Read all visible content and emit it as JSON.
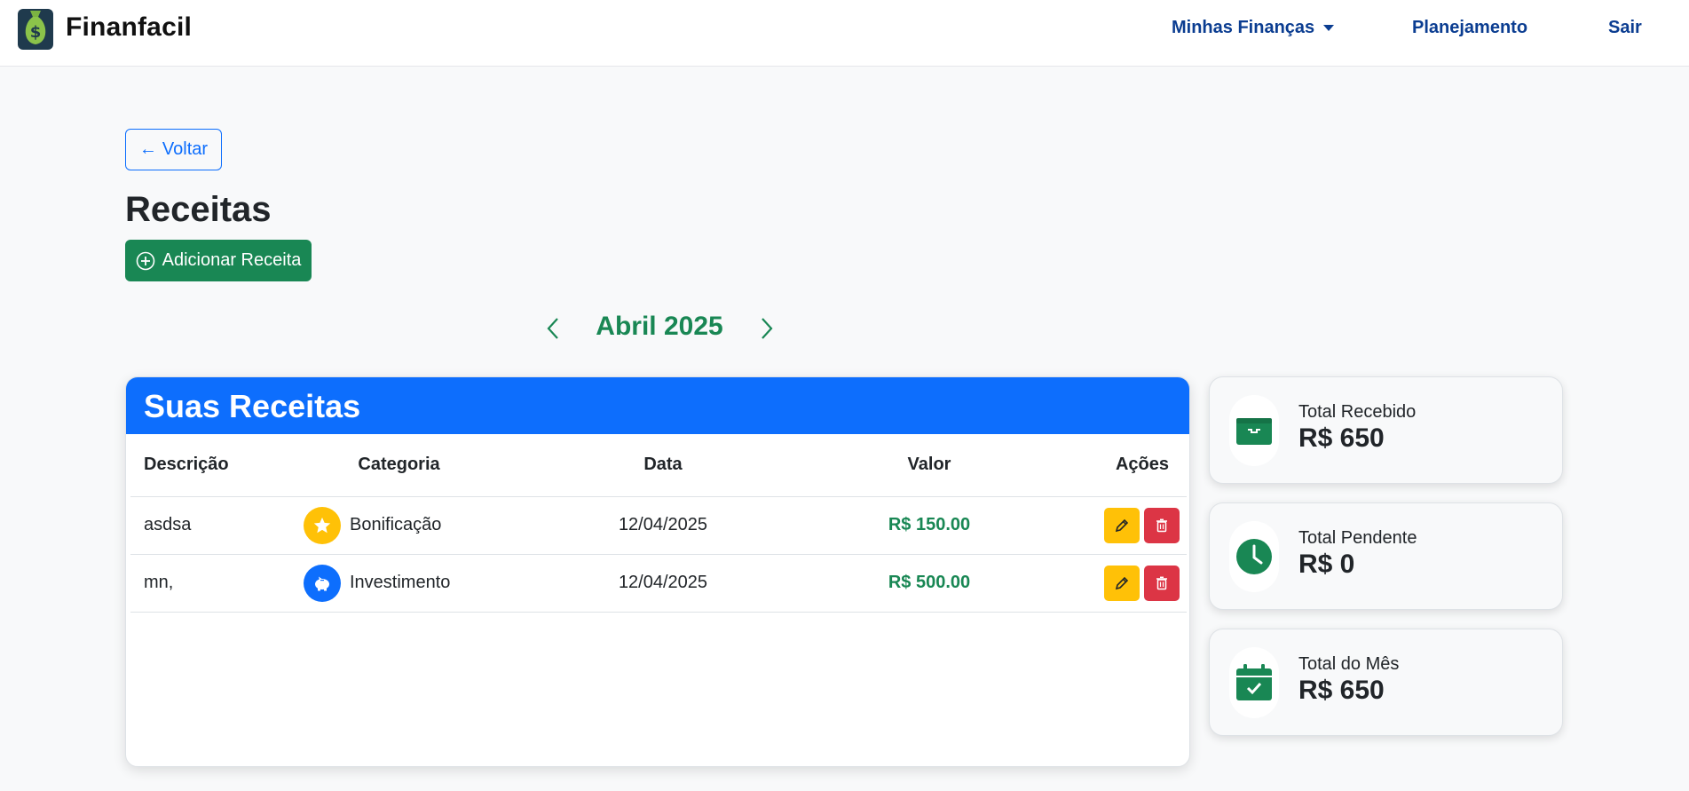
{
  "brand": {
    "name": "Finanfacil",
    "logo_icon": "money-bag-icon"
  },
  "nav": {
    "finances": "Minhas Finanças",
    "planning": "Planejamento",
    "logout": "Sair"
  },
  "back_button": {
    "label": "Voltar",
    "icon": "arrow-left-icon"
  },
  "page_title": "Receitas",
  "add_button": {
    "label": "Adicionar Receita",
    "icon": "plus-circle-icon"
  },
  "month_nav": {
    "label": "Abril 2025"
  },
  "table": {
    "header": "Suas Receitas",
    "columns": [
      "Descrição",
      "Categoria",
      "Data",
      "Valor",
      "Ações"
    ],
    "rows": [
      {
        "description": "asdsa",
        "category": "Bonificação",
        "category_icon": "star-icon",
        "category_color": "#ffc107",
        "date": "12/04/2025",
        "value": "R$ 150.00"
      },
      {
        "description": "mn,",
        "category": "Investimento",
        "category_icon": "piggy-bank-icon",
        "category_color": "#0d6efd",
        "date": "12/04/2025",
        "value": "R$ 500.00"
      }
    ]
  },
  "stats": [
    {
      "title": "Total Recebido",
      "value": "R$ 650",
      "icon": "wallet-icon"
    },
    {
      "title": "Total Pendente",
      "value": "R$ 0",
      "icon": "clock-icon"
    },
    {
      "title": "Total do Mês",
      "value": "R$ 650",
      "icon": "calendar-check-icon"
    }
  ],
  "colors": {
    "primary": "#0d6efd",
    "success": "#198754",
    "warning": "#ffc107",
    "danger": "#dc3545",
    "nav_text": "#0b3d91"
  }
}
